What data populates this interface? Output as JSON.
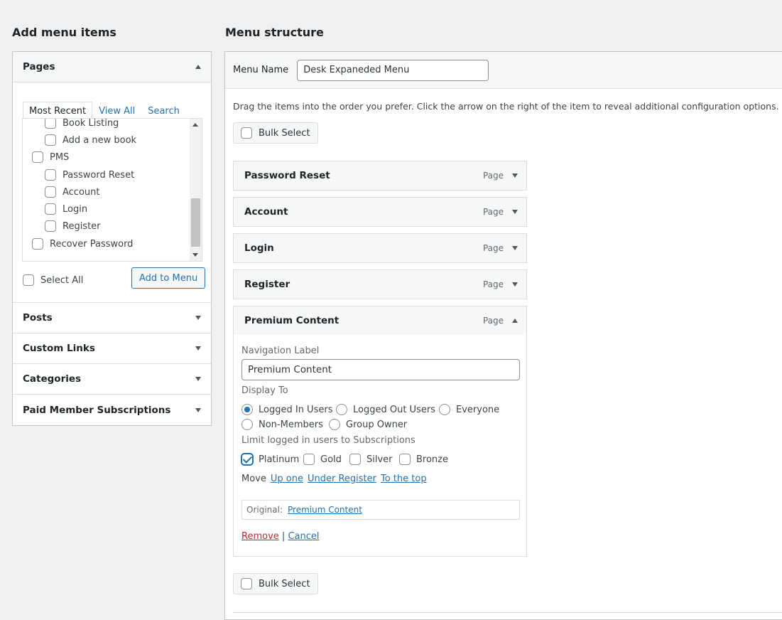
{
  "left": {
    "title": "Add menu items",
    "pages": {
      "label": "Pages",
      "tabs": [
        "Most Recent",
        "View All",
        "Search"
      ],
      "items": [
        {
          "label": "Book Listing"
        },
        {
          "label": "Add a new book"
        },
        {
          "label": "PMS"
        },
        {
          "label": "Password Reset"
        },
        {
          "label": "Account"
        },
        {
          "label": "Login"
        },
        {
          "label": "Register"
        },
        {
          "label": "Recover Password"
        }
      ],
      "select_all": "Select All",
      "add_button": "Add to Menu"
    },
    "sections": [
      "Posts",
      "Custom Links",
      "Categories",
      "Paid Member Subscriptions"
    ]
  },
  "right": {
    "title": "Menu structure",
    "menu_name_label": "Menu Name",
    "menu_name_value": "Desk Expaneded Menu",
    "instructions": "Drag the items into the order you prefer. Click the arrow on the right of the item to reveal additional configuration options.",
    "bulk_select": "Bulk Select",
    "items": [
      {
        "title": "Password Reset",
        "type": "Page"
      },
      {
        "title": "Account",
        "type": "Page"
      },
      {
        "title": "Login",
        "type": "Page"
      },
      {
        "title": "Register",
        "type": "Page"
      },
      {
        "title": "Premium Content",
        "type": "Page"
      }
    ],
    "settings": {
      "nav_label_label": "Navigation Label",
      "nav_label_value": "Premium Content",
      "display_to_label": "Display To",
      "display_options": [
        "Logged In Users",
        "Logged Out Users",
        "Everyone",
        "Non-Members",
        "Group Owner"
      ],
      "display_selected": "Logged In Users",
      "limit_label": "Limit logged in users to Subscriptions",
      "subscriptions": [
        {
          "label": "Platinum",
          "checked": true
        },
        {
          "label": "Gold",
          "checked": false
        },
        {
          "label": "Silver",
          "checked": false
        },
        {
          "label": "Bronze",
          "checked": false
        }
      ],
      "move_label": "Move",
      "move_links": [
        "Up one",
        "Under Register",
        "To the top"
      ],
      "original_label": "Original:",
      "original_link": "Premium Content",
      "remove": "Remove",
      "separator": "|",
      "cancel": "Cancel"
    }
  },
  "colors": {
    "accent": "#2271b1",
    "danger": "#b32d2e",
    "background": "#f0f0f1",
    "border": "#c3c4c7"
  }
}
